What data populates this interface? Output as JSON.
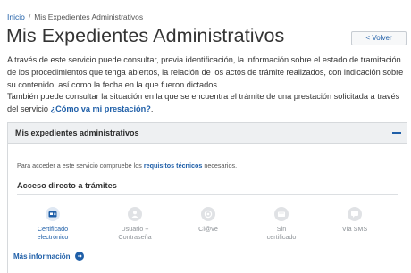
{
  "breadcrumb": {
    "home": "Inicio",
    "separator": "/",
    "current": "Mis Expedientes Administrativos"
  },
  "page_title": "Mis Expedientes Administrativos",
  "back_button": "< Volver",
  "intro": {
    "paragraph1": "A través de este servicio puede consultar, previa identificación, la información sobre el estado de tramitación de los procedimientos que tenga abiertos, la relación de los actos de trámite realizados, con indicación sobre su contenido, así como la fecha en la que fueron dictados.",
    "paragraph2_prefix": "También puede consultar la situación en la que se encuentra el trámite de una prestación solicitada a través del servicio ",
    "paragraph2_link": "¿Cómo va mi prestación?",
    "paragraph2_suffix": "."
  },
  "panel": {
    "title": "Mis expedientes administrativos",
    "requirements_prefix": "Para acceder a este servicio compruebe los ",
    "requirements_link": "requisitos técnicos",
    "requirements_suffix": " necesarios.",
    "access_title": "Acceso directo a trámites",
    "methods": [
      {
        "line1": "Certificado",
        "line2": "electrónico",
        "icon": "certificate-icon",
        "active": true
      },
      {
        "line1": "Usuario +",
        "line2": "Contraseña",
        "icon": "user-password-icon",
        "active": false
      },
      {
        "line1": "Cl@ve",
        "line2": "",
        "icon": "clave-icon",
        "active": false
      },
      {
        "line1": "Sin",
        "line2": "certificado",
        "icon": "no-certificate-icon",
        "active": false
      },
      {
        "line1": "Vía SMS",
        "line2": "",
        "icon": "sms-icon",
        "active": false
      }
    ],
    "more_info": "Más información"
  },
  "colors": {
    "link": "#1f5fa8",
    "panel_header": "#eef0f2",
    "disabled_text": "#8c9196"
  }
}
